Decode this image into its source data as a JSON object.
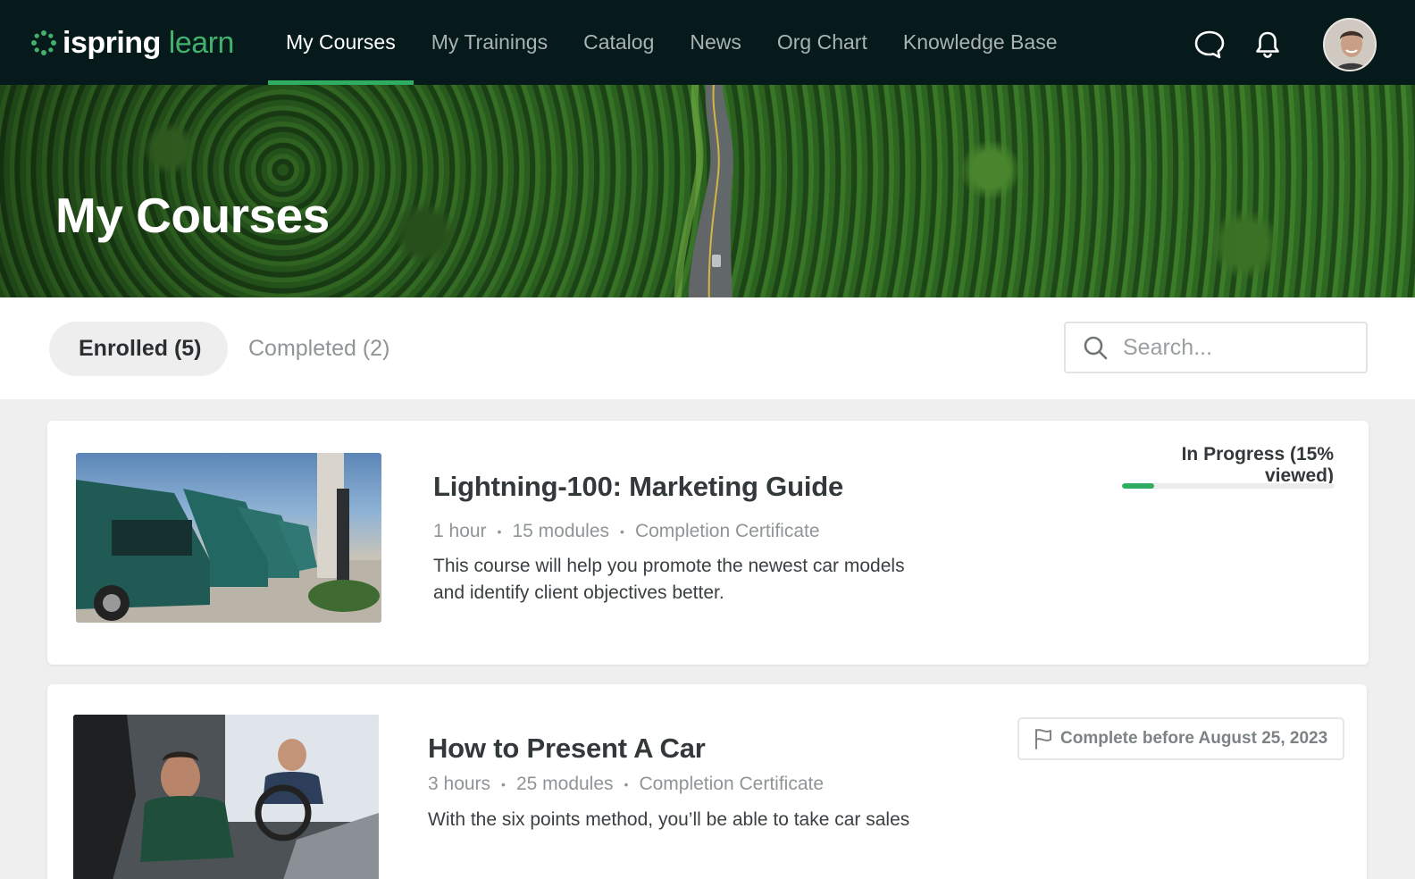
{
  "app": {
    "logo_word1": "ispring",
    "logo_word2": "learn"
  },
  "nav": {
    "items": [
      {
        "label": "My Courses",
        "active": true
      },
      {
        "label": "My Trainings",
        "active": false
      },
      {
        "label": "Catalog",
        "active": false
      },
      {
        "label": "News",
        "active": false
      },
      {
        "label": "Org Chart",
        "active": false
      },
      {
        "label": "Knowledge Base",
        "active": false
      }
    ],
    "icons": [
      "chat-bubble-icon",
      "bell-icon"
    ]
  },
  "hero": {
    "title": "My Courses"
  },
  "tabs": {
    "enrolled": "Enrolled (5)",
    "completed": "Completed (2)"
  },
  "search": {
    "placeholder": "Search..."
  },
  "courses": [
    {
      "title": "Lightning-100: Marketing Guide",
      "meta": [
        "1 hour",
        "15 modules",
        "Completion Certificate"
      ],
      "description": "This course will help you promote the newest car models and identify client objectives better.",
      "status": "In Progress (15% viewed)",
      "progress_percent": 15
    },
    {
      "title": "How to Present A Car",
      "meta": [
        "3 hours",
        "25 modules",
        "Completion Certificate"
      ],
      "description": "With the six points method, you’ll be able to take car sales",
      "deadline": "Complete before August 25, 2023"
    }
  ],
  "colors": {
    "accent": "#2fae62",
    "topbar": "#06191b"
  }
}
